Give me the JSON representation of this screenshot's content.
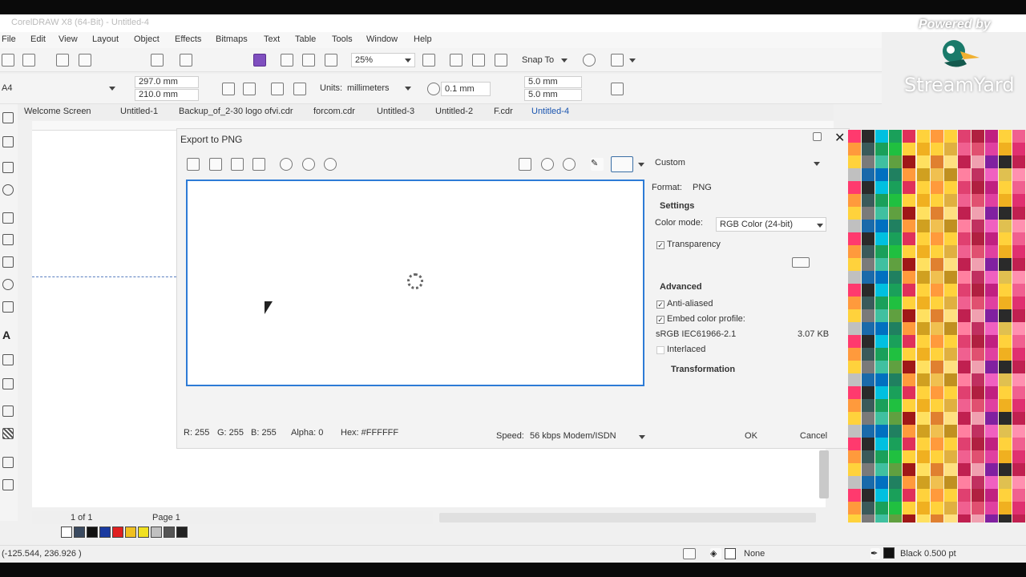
{
  "window": {
    "title": "CorelDRAW X8 (64-Bit) - Untitled-4"
  },
  "menu": [
    "File",
    "Edit",
    "View",
    "Layout",
    "Object",
    "Effects",
    "Bitmaps",
    "Text",
    "Table",
    "Tools",
    "Window",
    "Help"
  ],
  "toolbar": {
    "zoom": "25%",
    "snap_to": "Snap To"
  },
  "property_bar": {
    "page_size": "A4",
    "width": "297.0 mm",
    "height": "210.0 mm",
    "units_label": "Units:",
    "units": "millimeters",
    "nudge": "0.1 mm",
    "dup_x": "5.0 mm",
    "dup_y": "5.0 mm"
  },
  "tabs": [
    "Welcome Screen",
    "Untitled-1",
    "Backup_of_2-30 logo ofvi.cdr",
    "forcom.cdr",
    "Untitled-3",
    "Untitled-2",
    "F.cdr",
    "Untitled-4"
  ],
  "dialog": {
    "title": "Export to PNG",
    "preset": "Custom",
    "format_label": "Format:",
    "format": "PNG",
    "settings_header": "Settings",
    "color_mode_label": "Color mode:",
    "color_mode": "RGB Color (24-bit)",
    "transparency": "Transparency",
    "advanced_header": "Advanced",
    "anti_aliased": "Anti-aliased",
    "embed_profile": "Embed color profile:",
    "profile_name": "sRGB IEC61966-2.1",
    "file_size": "3.07 KB",
    "interlaced": "Interlaced",
    "transformation_header": "Transformation",
    "color_readout": {
      "r": "R: 255",
      "g": "G: 255",
      "b": "B: 255",
      "alpha": "Alpha: 0",
      "hex": "Hex: #FFFFFF"
    },
    "speed_label": "Speed:",
    "speed": "56 kbps Modem/ISDN",
    "ok": "OK",
    "cancel": "Cancel"
  },
  "page_nav": {
    "counter": "1 of 1",
    "page_tab": "Page 1"
  },
  "status": {
    "coords": "(-125.544, 236.926 )",
    "fill": "None",
    "outline": "Black  0.500 pt"
  },
  "overlay": {
    "powered": "Powered by",
    "brand": "StreamYard"
  },
  "colors": {
    "accent": "#2d7bd6",
    "palette_a": [
      "#ff3a6e",
      "#ff9a3c",
      "#ffd23c",
      "#c0c0c0",
      "#7a2a2a",
      "#f06090"
    ],
    "palette_b": [
      "#2a2a2a",
      "#3a5a5a",
      "#1a6aaa",
      "#00c0e0",
      "#1aa05a",
      "#0070c0"
    ]
  }
}
